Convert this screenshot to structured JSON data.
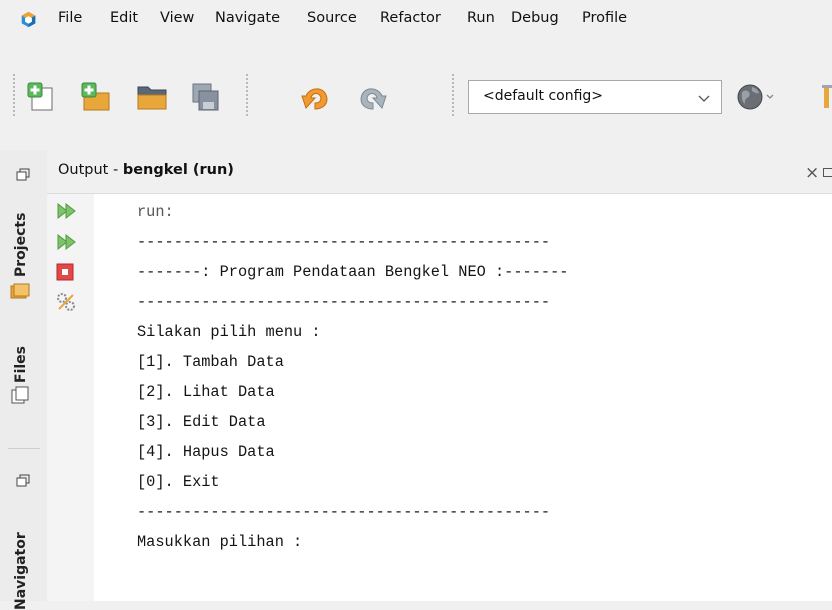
{
  "menubar": {
    "items": [
      "File",
      "Edit",
      "View",
      "Navigate",
      "Source",
      "Refactor",
      "Run",
      "Debug",
      "Profile"
    ]
  },
  "toolbar": {
    "config_select": "<default config>",
    "icons": [
      "new-project-icon",
      "new-file-icon",
      "open-project-icon",
      "save-all-icon",
      "undo-icon",
      "redo-icon",
      "globe-icon",
      "build-icon"
    ]
  },
  "leftbar": {
    "tabs": [
      "Projects",
      "Files",
      "Navigator"
    ]
  },
  "output": {
    "title_prefix": "Output - ",
    "title_bold": "bengkel (run)",
    "lines": [
      "run:",
      "---------------------------------------------",
      "-------: Program Pendataan Bengkel NEO :-------",
      "---------------------------------------------",
      "Silakan pilih menu :",
      "[1]. Tambah Data",
      "[2]. Lihat Data",
      "[3]. Edit Data",
      "[4]. Hapus Data",
      "[0]. Exit",
      "---------------------------------------------",
      "Masukkan pilihan :"
    ]
  },
  "colors": {
    "green_arrow": "#7cc36a",
    "stop_red": "#e34848",
    "logo_blue": "#2b8fd6",
    "logo_orange": "#f2a12f"
  }
}
